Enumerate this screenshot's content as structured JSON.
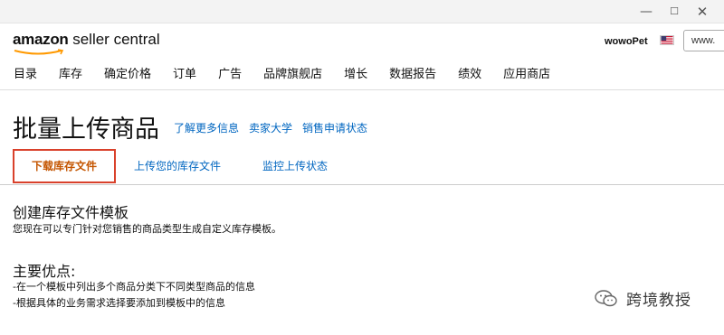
{
  "window": {
    "minimize_glyph": "—",
    "maximize_glyph": "☐",
    "close_glyph": "✕"
  },
  "header": {
    "logo_brand": "amazon",
    "logo_product": " seller central",
    "account_name": "wowoPet",
    "flag_icon": "us-flag-icon",
    "search_value": "www."
  },
  "nav": {
    "items": [
      "目录",
      "库存",
      "确定价格",
      "订单",
      "广告",
      "品牌旗舰店",
      "增长",
      "数据报告",
      "绩效",
      "应用商店"
    ]
  },
  "page": {
    "title": "批量上传商品",
    "links": [
      "了解更多信息",
      "卖家大学",
      "销售申请状态"
    ]
  },
  "tabs": {
    "items": [
      "下载库存文件",
      "上传您的库存文件",
      "监控上传状态"
    ],
    "active_index": 0,
    "active_border_color": "#d9412b"
  },
  "content": {
    "section_title": "创建库存文件模板",
    "section_desc": "您现在可以专门针对您销售的商品类型生成自定义库存模板。",
    "advantages_title": "主要优点:",
    "advantages": [
      "-在一个模板中列出多个商品分类下不同类型商品的信息",
      "-根据具体的业务需求选择要添加到模板中的信息"
    ]
  },
  "watermark": {
    "icon": "wechat-icon",
    "text": "跨境教授"
  },
  "colors": {
    "link": "#0066c0",
    "active_tab_text": "#c45500"
  }
}
